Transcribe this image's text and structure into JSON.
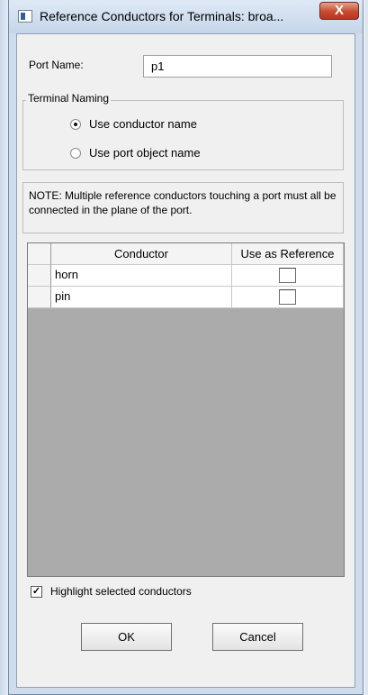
{
  "window": {
    "title": "Reference Conductors for Terminals: broa...",
    "close_glyph": "X"
  },
  "port": {
    "label": "Port Name:",
    "value": "p1"
  },
  "terminal_naming": {
    "legend": "Terminal Naming",
    "options": [
      {
        "label": "Use conductor name",
        "selected": true
      },
      {
        "label": "Use port object name",
        "selected": false
      }
    ]
  },
  "note": {
    "text": "NOTE: Multiple reference conductors touching a port must all be connected in the plane of the port."
  },
  "table": {
    "columns": [
      "Conductor",
      "Use as Reference"
    ],
    "rows": [
      {
        "conductor": "horn",
        "use_as_reference": false
      },
      {
        "conductor": "pin",
        "use_as_reference": false
      }
    ]
  },
  "highlight": {
    "label": "Highlight selected conductors",
    "checked": true,
    "check_glyph": "✓"
  },
  "buttons": {
    "ok": "OK",
    "cancel": "Cancel"
  }
}
